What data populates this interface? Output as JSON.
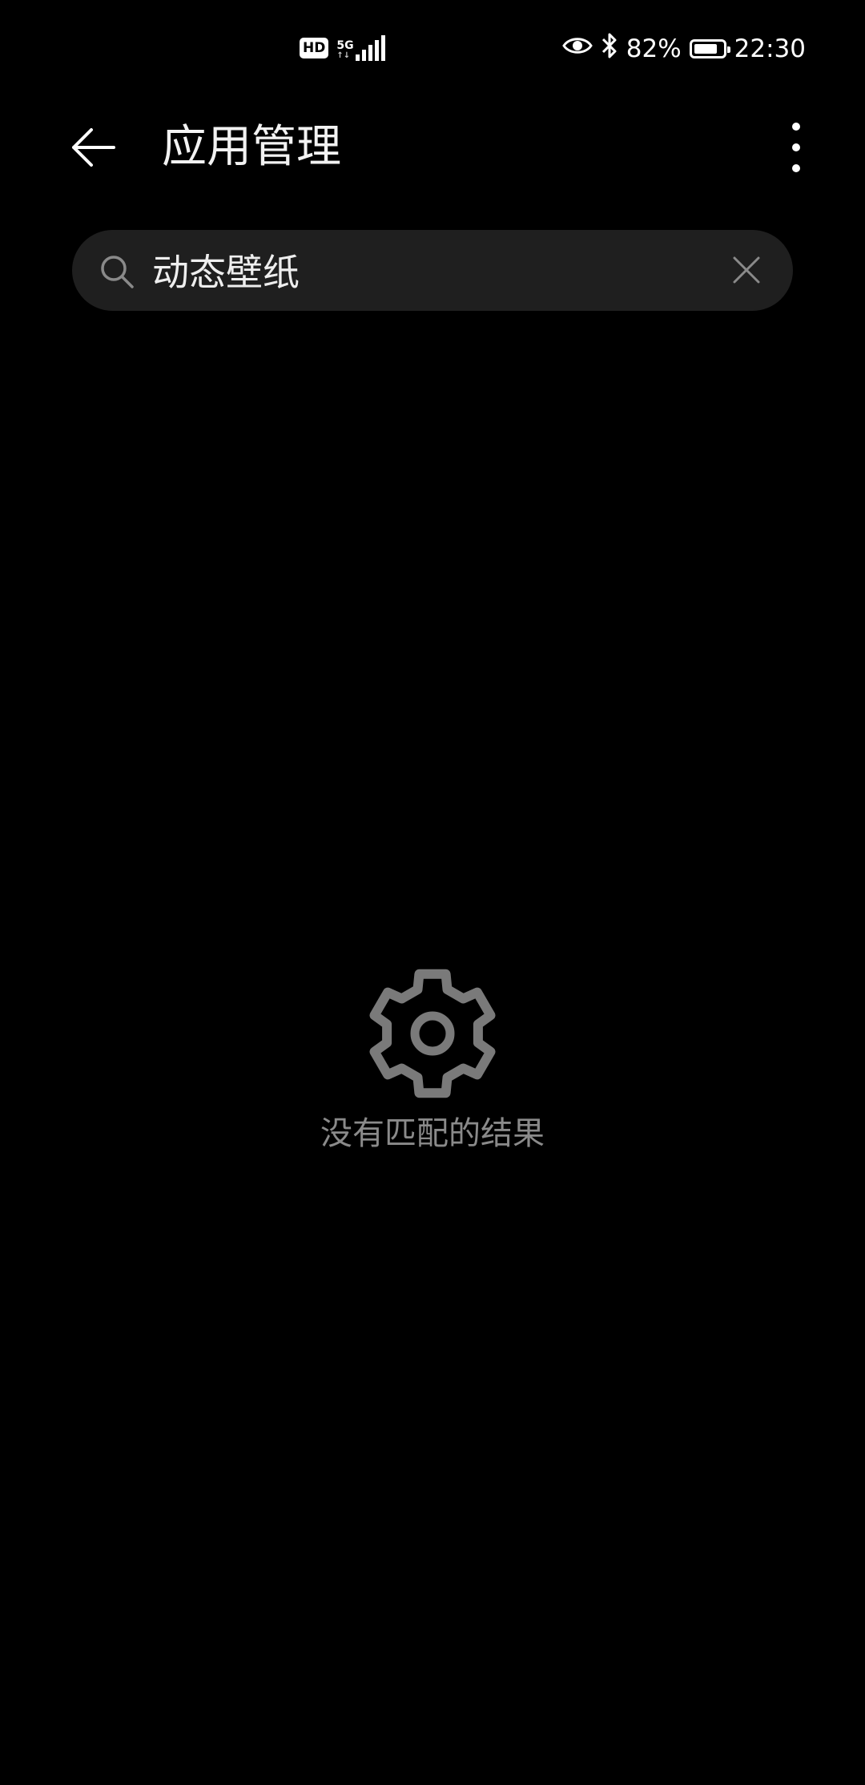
{
  "status_bar": {
    "hd_label": "HD",
    "network_type": "5G",
    "network_arrows": "↑↓",
    "battery_percent": "82%",
    "battery_level": 0.82,
    "time": "22:30",
    "icons": [
      "eye-comfort-icon",
      "bluetooth-icon",
      "battery-icon",
      "signal-icon"
    ]
  },
  "app_bar": {
    "title": "应用管理",
    "back_icon": "arrow-left-icon",
    "more_icon": "more-vertical-icon"
  },
  "search": {
    "value": "动态壁纸",
    "placeholder": "",
    "search_icon": "search-icon",
    "clear_icon": "close-icon"
  },
  "empty_state": {
    "icon": "gear-icon",
    "message": "没有匹配的结果"
  },
  "colors": {
    "background": "#000000",
    "search_bg": "#1f1f1f",
    "muted_text": "#8a8a8a",
    "icon_gray": "#7a7a7a"
  }
}
